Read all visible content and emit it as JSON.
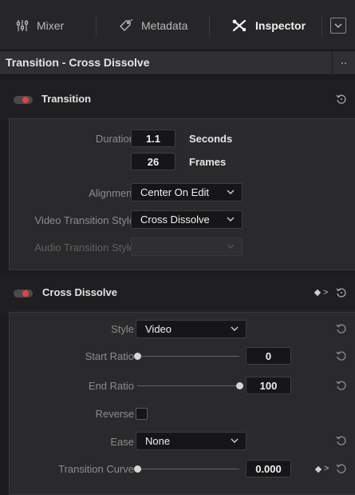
{
  "tabs": [
    {
      "label": "Mixer",
      "icon": "mixer-sliders-icon"
    },
    {
      "label": "Metadata",
      "icon": "metadata-tag-icon"
    },
    {
      "label": "Inspector",
      "icon": "inspector-tools-icon",
      "active": true
    }
  ],
  "panel": {
    "title": "Transition - Cross Dissolve"
  },
  "transition": {
    "title": "Transition",
    "enabled": true,
    "duration_label": "Duration",
    "duration_seconds": "1.1",
    "seconds_unit": "Seconds",
    "duration_frames": "26",
    "frames_unit": "Frames",
    "alignment_label": "Alignment",
    "alignment_value": "Center On Edit",
    "video_style_label": "Video Transition Style",
    "video_style_value": "Cross Dissolve",
    "audio_style_label": "Audio Transition Style",
    "audio_style_value": ""
  },
  "cross_dissolve": {
    "title": "Cross Dissolve",
    "enabled": true,
    "style_label": "Style",
    "style_value": "Video",
    "start_ratio_label": "Start Ratio",
    "start_ratio_value": "0",
    "start_ratio_level": 0,
    "end_ratio_label": "End Ratio",
    "end_ratio_value": "100",
    "end_ratio_level": 1,
    "reverse_label": "Reverse",
    "reverse_checked": false,
    "ease_label": "Ease",
    "ease_value": "None",
    "curve_label": "Transition Curve",
    "curve_value": "0.000",
    "curve_level": 0
  },
  "colors": {
    "toggle_on": "#e84040",
    "active_tab_text": "#f0f0f0"
  }
}
